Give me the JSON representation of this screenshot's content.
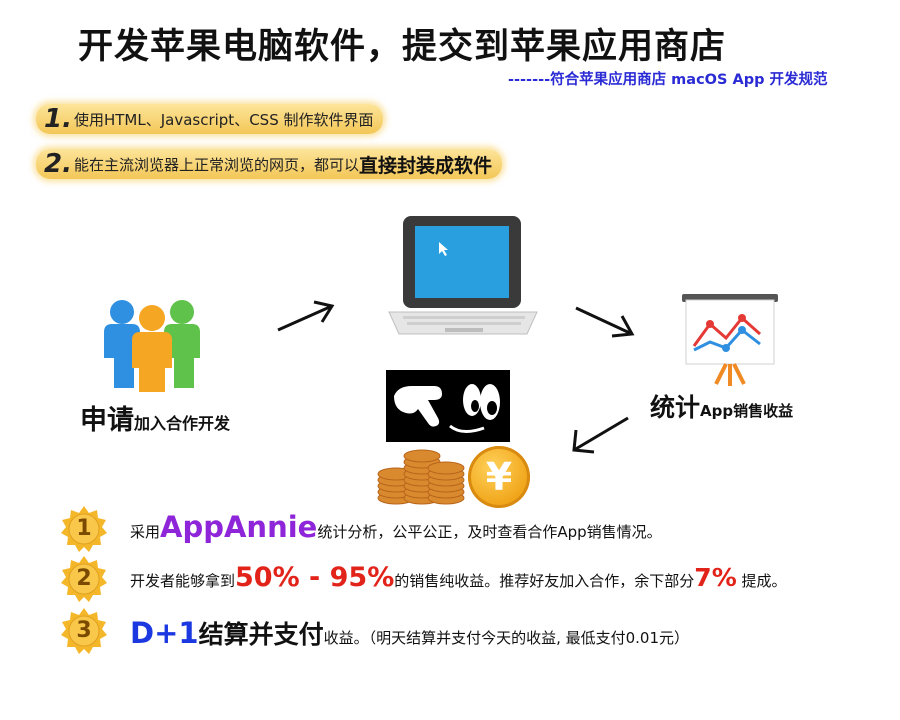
{
  "header": {
    "title": "开发苹果电脑软件，提交到苹果应用商店",
    "subtitle": "-------符合苹果应用商店 macOS App 开发规范"
  },
  "steps": [
    {
      "num": "1.",
      "text": "使用HTML、Javascript、CSS 制作软件界面",
      "strong": ""
    },
    {
      "num": "2.",
      "text": "能在主流浏览器上正常浏览的网页，都可以",
      "strong": "直接封装成软件"
    }
  ],
  "flow": {
    "apply_big": "申请",
    "apply_small": "加入合作开发",
    "stat_big": "统计",
    "stat_small": "App销售收益",
    "yen_symbol": "¥"
  },
  "benefits": [
    {
      "medal": "1",
      "prefix": "采用",
      "highlight": "AppAnnie",
      "rest": "统计分析，公平公正，及时查看合作App销售情况。"
    },
    {
      "medal": "2",
      "prefix": "开发者能够拿到",
      "highlight": "50% - 95%",
      "middle": "的销售纯收益。推荐好友加入合作，余下部分",
      "highlight2": "7%",
      "rest": " 提成。"
    },
    {
      "medal": "3",
      "highlight": "D+1",
      "bold": "结算并支付",
      "rest": "收益。（明天结算并支付今天的收益, 最低支付0.01元）"
    }
  ],
  "colors": {
    "subtitle": "#2b2bd6",
    "purple": "#8e25d8",
    "red": "#e2231a",
    "blue": "#1c38e0",
    "step_bg": "#f3c757"
  },
  "icons": [
    "people-icon",
    "laptop-icon",
    "chart-board-icon",
    "hand-eyes-icon",
    "coins-icon",
    "yen-coin-icon",
    "arrow-icon",
    "medal-icon"
  ]
}
